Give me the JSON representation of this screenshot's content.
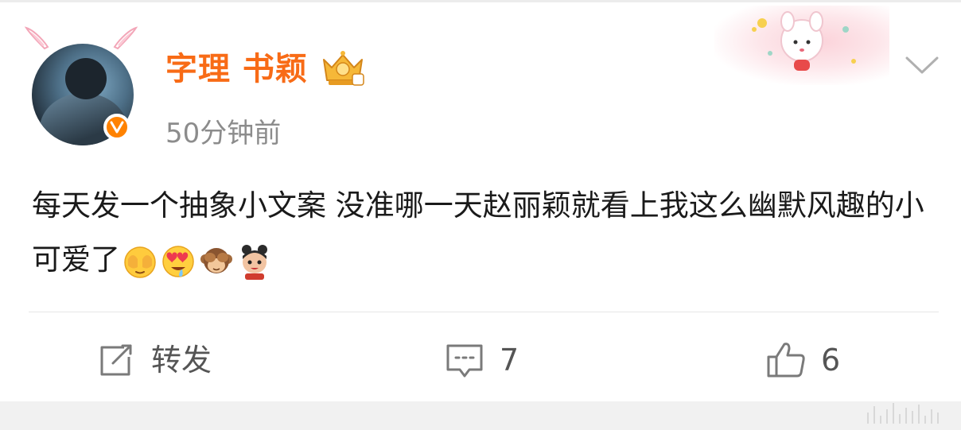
{
  "header": {
    "user_name": "字理 书颖",
    "post_time": "50分钟前",
    "icons": {
      "avatar_verify": "verified-v-icon",
      "rank_badge": "crown-badge-icon",
      "more": "chevron-down-icon"
    }
  },
  "post": {
    "text": "每天发一个抽象小文案 没准哪一天赵丽颖就看上我这么幽默风趣的小可爱了",
    "emojis": [
      "shy-face-emoji",
      "heart-eyes-drool-emoji",
      "see-no-evil-monkey-emoji",
      "nezha-emoji"
    ]
  },
  "actions": {
    "repost_label": "转发",
    "comment_count": "7",
    "like_count": "6"
  },
  "colors": {
    "name": "#f86b16",
    "verify": "#ff8200",
    "time": "#8c8c8c",
    "action": "#555555"
  }
}
